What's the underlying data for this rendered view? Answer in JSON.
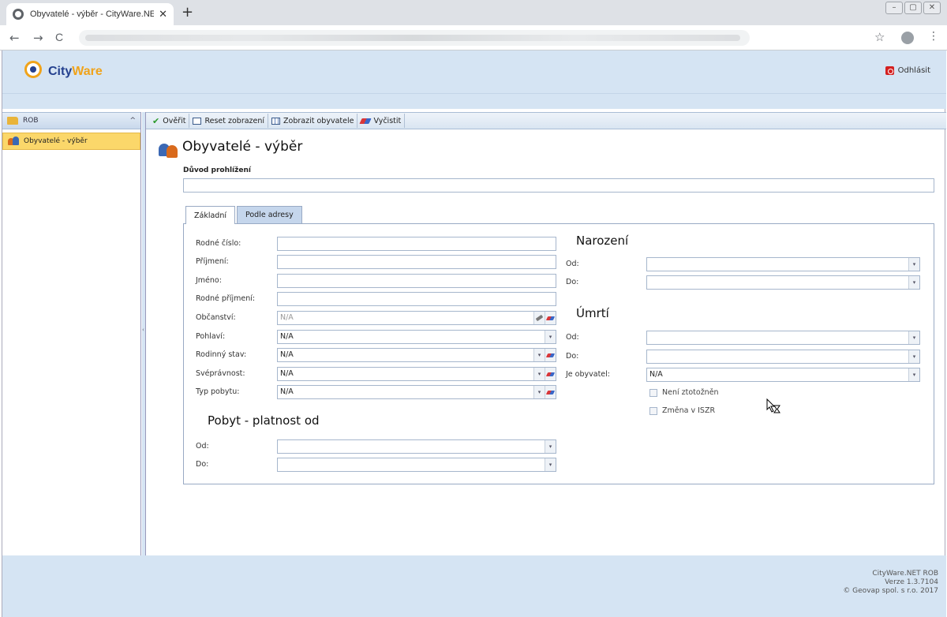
{
  "browser": {
    "tab_title": "Obyvatelé - výběr - CityWare.NET R",
    "close_glyph": "✕",
    "new_tab_glyph": "+",
    "back_glyph": "←",
    "forward_glyph": "→",
    "reload_glyph": "C",
    "star_glyph": "☆",
    "menu_glyph": "⋮",
    "win_min": "–",
    "win_max": "▢",
    "win_close": "✕"
  },
  "header": {
    "logo_city": "City",
    "logo_ware": "Ware",
    "logout_label": "Odhlásit"
  },
  "sidebar": {
    "section_label": "ROB",
    "collapse_glyph": "^",
    "items": [
      {
        "label": "Obyvatelé - výběr"
      }
    ]
  },
  "splitter_glyph": "‹",
  "toolbar": {
    "verify_label": "Ověřit",
    "verify_glyph": "✔",
    "reset_label": "Reset zobrazení",
    "show_label": "Zobrazit obyvatele",
    "clear_label": "Vyčistit"
  },
  "main": {
    "title": "Obyvatelé - výběr",
    "reason_label": "Důvod prohlížení",
    "tabs": [
      {
        "label": "Základní",
        "active": true
      },
      {
        "label": "Podle adresy",
        "active": false
      }
    ],
    "dropdown_glyph": "▾",
    "na": "N/A",
    "fields": {
      "rodne_cislo": "Rodné číslo:",
      "prijmeni": "Příjmení:",
      "jmeno": "Jméno:",
      "rodne_prijmeni": "Rodné příjmení:",
      "obcanstvi": "Občanství:",
      "pohlavi": "Pohlaví:",
      "rodinny_stav": "Rodinný stav:",
      "svepravnost": "Svéprávnost:",
      "typ_pobytu": "Typ pobytu:"
    },
    "pobyt": {
      "title": "Pobyt - platnost od",
      "od": "Od:",
      "do": "Do:"
    },
    "narozeni": {
      "title": "Narození",
      "od": "Od:",
      "do": "Do:"
    },
    "umrti": {
      "title": "Úmrtí",
      "od": "Od:",
      "do": "Do:"
    },
    "je_obyvatel": "Je obyvatel:",
    "checkboxes": {
      "neni_ztotoznen": "Není ztotožněn",
      "zmena_iszr": "Změna v ISZR"
    }
  },
  "footer": {
    "line1": "CityWare.NET ROB",
    "line2": "Verze 1.3.7104",
    "line3": "© Geovap spol. s r.o. 2017"
  },
  "colors": {
    "header_bg": "#d5e4f3",
    "active_item_bg": "#fbd76a",
    "brand_blue": "#24408e",
    "brand_orange": "#f0a31a"
  }
}
